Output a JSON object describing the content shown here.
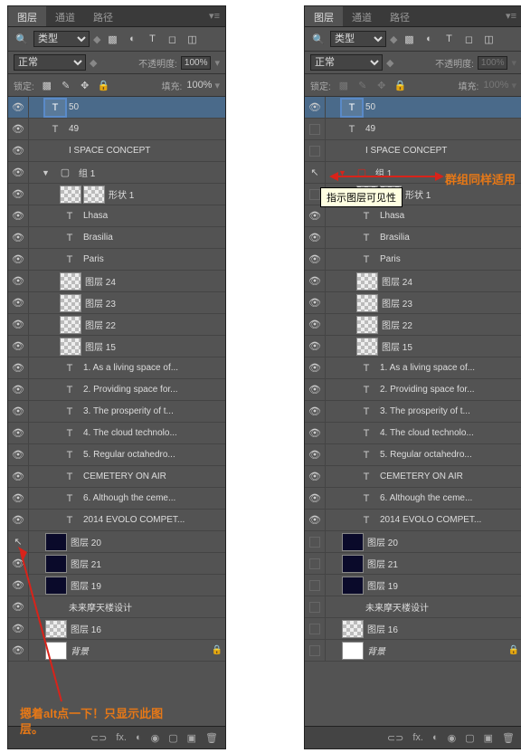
{
  "tabs": {
    "layers": "图层",
    "channels": "通道",
    "paths": "路径"
  },
  "filter": {
    "kind": "类型"
  },
  "blend": {
    "mode": "正常",
    "opacityLabel": "不透明度:",
    "opacity": "100%"
  },
  "lock": {
    "label": "锁定:",
    "fillLabel": "填充:",
    "fill": "100%"
  },
  "layers": [
    {
      "eye": true,
      "type": "text-sel",
      "name": "50",
      "indent": 0,
      "selected": true
    },
    {
      "eye": true,
      "type": "text",
      "name": "49",
      "indent": 0
    },
    {
      "eye": true,
      "type": "label",
      "name": "I    SPACE CONCEPT",
      "indent": 0
    },
    {
      "eye": true,
      "type": "group",
      "name": "组 1",
      "indent": 0,
      "open": true
    },
    {
      "eye": true,
      "type": "shape",
      "name": "形状 1",
      "indent": 1
    },
    {
      "eye": true,
      "type": "text",
      "name": "Lhasa",
      "indent": 1
    },
    {
      "eye": true,
      "type": "text",
      "name": "Brasilia",
      "indent": 1
    },
    {
      "eye": true,
      "type": "text",
      "name": "Paris",
      "indent": 1
    },
    {
      "eye": true,
      "type": "checker",
      "name": "图层 24",
      "indent": 1
    },
    {
      "eye": true,
      "type": "checker",
      "name": "图层 23",
      "indent": 1
    },
    {
      "eye": true,
      "type": "checker",
      "name": "图层 22",
      "indent": 1
    },
    {
      "eye": true,
      "type": "checker",
      "name": "图层 15",
      "indent": 1
    },
    {
      "eye": true,
      "type": "text",
      "name": "1. As a living space of...",
      "indent": 1
    },
    {
      "eye": true,
      "type": "text",
      "name": "2. Providing space for...",
      "indent": 1
    },
    {
      "eye": true,
      "type": "text",
      "name": "3. The prosperity of t...",
      "indent": 1
    },
    {
      "eye": true,
      "type": "text",
      "name": "4. The cloud technolo...",
      "indent": 1
    },
    {
      "eye": true,
      "type": "text",
      "name": "5. Regular octahedro...",
      "indent": 1
    },
    {
      "eye": true,
      "type": "text",
      "name": "CEMETERY ON AIR",
      "indent": 1
    },
    {
      "eye": true,
      "type": "text",
      "name": "6. Although the ceme...",
      "indent": 1
    },
    {
      "eye": true,
      "type": "text",
      "name": "2014 EVOLO COMPET...",
      "indent": 1
    },
    {
      "eye": "cursor",
      "type": "dark",
      "name": "图层 20",
      "indent": 0
    },
    {
      "eye": true,
      "type": "dark",
      "name": "图层 21",
      "indent": 0
    },
    {
      "eye": true,
      "type": "dark",
      "name": "图层 19",
      "indent": 0
    },
    {
      "eye": true,
      "type": "label",
      "name": "未来摩天楼设计",
      "indent": 0
    },
    {
      "eye": true,
      "type": "checker",
      "name": "图层 16",
      "indent": 0
    },
    {
      "eye": true,
      "type": "white",
      "name": "背景",
      "indent": 0,
      "locked": true,
      "italic": true
    }
  ],
  "rightLayers": [
    {
      "eye": true,
      "type": "text-sel",
      "name": "50",
      "indent": 0,
      "selected": true
    },
    {
      "eye": "box",
      "type": "text",
      "name": "49",
      "indent": 0
    },
    {
      "eye": "box",
      "type": "label",
      "name": "I    SPACE CONCEPT",
      "indent": 0
    },
    {
      "eye": "cursor",
      "type": "group-red",
      "name": "组 1",
      "indent": 0,
      "open": true
    },
    {
      "eye": "box",
      "type": "shape",
      "name": "形状 1",
      "indent": 1,
      "tooltip": true
    },
    {
      "eye": true,
      "type": "text",
      "name": "Lhasa",
      "indent": 1
    },
    {
      "eye": true,
      "type": "text",
      "name": "Brasilia",
      "indent": 1
    },
    {
      "eye": true,
      "type": "text",
      "name": "Paris",
      "indent": 1
    },
    {
      "eye": true,
      "type": "checker",
      "name": "图层 24",
      "indent": 1
    },
    {
      "eye": true,
      "type": "checker",
      "name": "图层 23",
      "indent": 1
    },
    {
      "eye": true,
      "type": "checker",
      "name": "图层 22",
      "indent": 1
    },
    {
      "eye": true,
      "type": "checker",
      "name": "图层 15",
      "indent": 1
    },
    {
      "eye": true,
      "type": "text",
      "name": "1. As a living space of...",
      "indent": 1
    },
    {
      "eye": true,
      "type": "text",
      "name": "2. Providing space for...",
      "indent": 1
    },
    {
      "eye": true,
      "type": "text",
      "name": "3. The prosperity of t...",
      "indent": 1
    },
    {
      "eye": true,
      "type": "text",
      "name": "4. The cloud technolo...",
      "indent": 1
    },
    {
      "eye": true,
      "type": "text",
      "name": "5. Regular octahedro...",
      "indent": 1
    },
    {
      "eye": true,
      "type": "text",
      "name": "CEMETERY ON AIR",
      "indent": 1
    },
    {
      "eye": true,
      "type": "text",
      "name": "6. Although the ceme...",
      "indent": 1
    },
    {
      "eye": true,
      "type": "text",
      "name": "2014 EVOLO COMPET...",
      "indent": 1
    },
    {
      "eye": "box",
      "type": "dark",
      "name": "图层 20",
      "indent": 0
    },
    {
      "eye": "box",
      "type": "dark",
      "name": "图层 21",
      "indent": 0
    },
    {
      "eye": "box",
      "type": "dark",
      "name": "图层 19",
      "indent": 0
    },
    {
      "eye": "box",
      "type": "label",
      "name": "未来摩天楼设计",
      "indent": 0
    },
    {
      "eye": "box",
      "type": "checker",
      "name": "图层 16",
      "indent": 0
    },
    {
      "eye": "box",
      "type": "white",
      "name": "背景",
      "indent": 0,
      "locked": true,
      "italic": true
    }
  ],
  "annotations": {
    "leftNote": "摁着alt点一下！只显示此图层。",
    "rightNote": "群组同样适用",
    "tooltip": "指示图层可见性"
  },
  "bottomIcons": {
    "link": "⊂⊃",
    "fx": "fx.",
    "mask": "◐",
    "adj": "◉",
    "folder": "▢",
    "new": "▣",
    "trash": "🗑"
  }
}
